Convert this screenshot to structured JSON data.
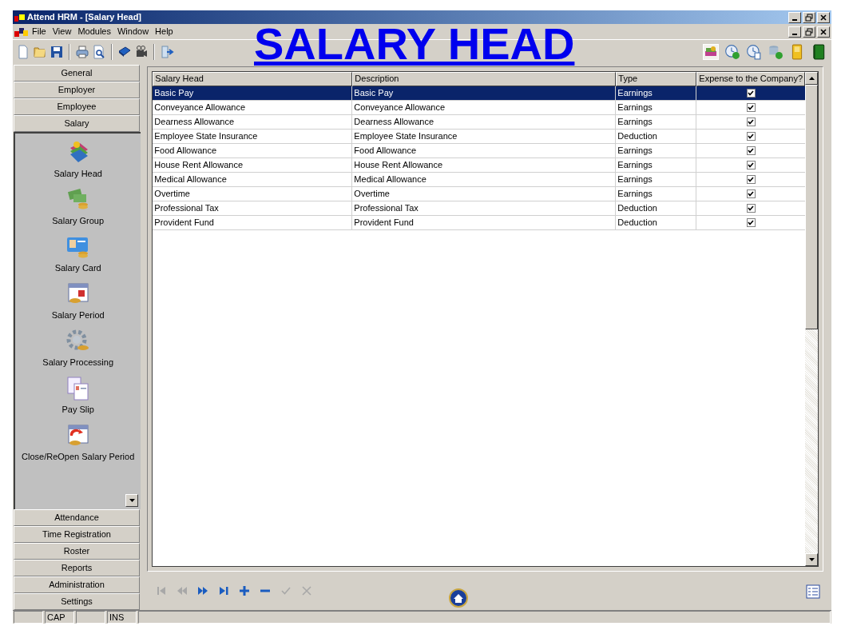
{
  "window": {
    "title": "Attend HRM - [Salary Head]"
  },
  "menu": [
    "File",
    "View",
    "Modules",
    "Window",
    "Help"
  ],
  "overlay_title": "SALARY HEAD",
  "sidebar": {
    "sections": [
      {
        "label": "General",
        "expanded": false
      },
      {
        "label": "Employer",
        "expanded": false
      },
      {
        "label": "Employee",
        "expanded": false
      },
      {
        "label": "Salary",
        "expanded": true,
        "items": [
          "Salary Head",
          "Salary Group",
          "Salary Card",
          "Salary Period",
          "Salary Processing",
          "Pay Slip",
          "Close/ReOpen Salary Period"
        ]
      },
      {
        "label": "Attendance",
        "expanded": false
      },
      {
        "label": "Time Registration",
        "expanded": false
      },
      {
        "label": "Roster",
        "expanded": false
      },
      {
        "label": "Reports",
        "expanded": false
      },
      {
        "label": "Administration",
        "expanded": false
      },
      {
        "label": "Settings",
        "expanded": false
      }
    ]
  },
  "table": {
    "columns": [
      "Salary Head",
      "Description",
      "Type",
      "Expense to the Company?"
    ],
    "rows": [
      {
        "cells": [
          "Basic Pay",
          "Basic Pay",
          "Earnings"
        ],
        "expense": true,
        "selected": true
      },
      {
        "cells": [
          "Conveyance Allowance",
          "Conveyance Allowance",
          "Earnings"
        ],
        "expense": true,
        "selected": false
      },
      {
        "cells": [
          "Dearness Allowance",
          "Dearness Allowance",
          "Earnings"
        ],
        "expense": true,
        "selected": false
      },
      {
        "cells": [
          "Employee State Insurance",
          "Employee State Insurance",
          "Deduction"
        ],
        "expense": true,
        "selected": false
      },
      {
        "cells": [
          "Food Allowance",
          "Food Allowance",
          "Earnings"
        ],
        "expense": true,
        "selected": false
      },
      {
        "cells": [
          "House Rent Allowance",
          "House Rent Allowance",
          "Earnings"
        ],
        "expense": true,
        "selected": false
      },
      {
        "cells": [
          "Medical Allowance",
          "Medical Allowance",
          "Earnings"
        ],
        "expense": true,
        "selected": false
      },
      {
        "cells": [
          "Overtime",
          "Overtime",
          "Earnings"
        ],
        "expense": true,
        "selected": false
      },
      {
        "cells": [
          "Professional Tax",
          "Professional Tax",
          "Deduction"
        ],
        "expense": true,
        "selected": false
      },
      {
        "cells": [
          "Provident Fund",
          "Provident Fund",
          "Deduction"
        ],
        "expense": true,
        "selected": false
      }
    ]
  },
  "navigator": [
    {
      "kind": "first",
      "disabled": true
    },
    {
      "kind": "prior",
      "disabled": true
    },
    {
      "kind": "next",
      "disabled": false
    },
    {
      "kind": "last",
      "disabled": false
    },
    {
      "kind": "insert",
      "disabled": false
    },
    {
      "kind": "delete",
      "disabled": false
    },
    {
      "kind": "post",
      "disabled": true
    },
    {
      "kind": "cancel",
      "disabled": true
    }
  ],
  "status_bar": {
    "panels": [
      "CAP",
      "INS"
    ]
  }
}
